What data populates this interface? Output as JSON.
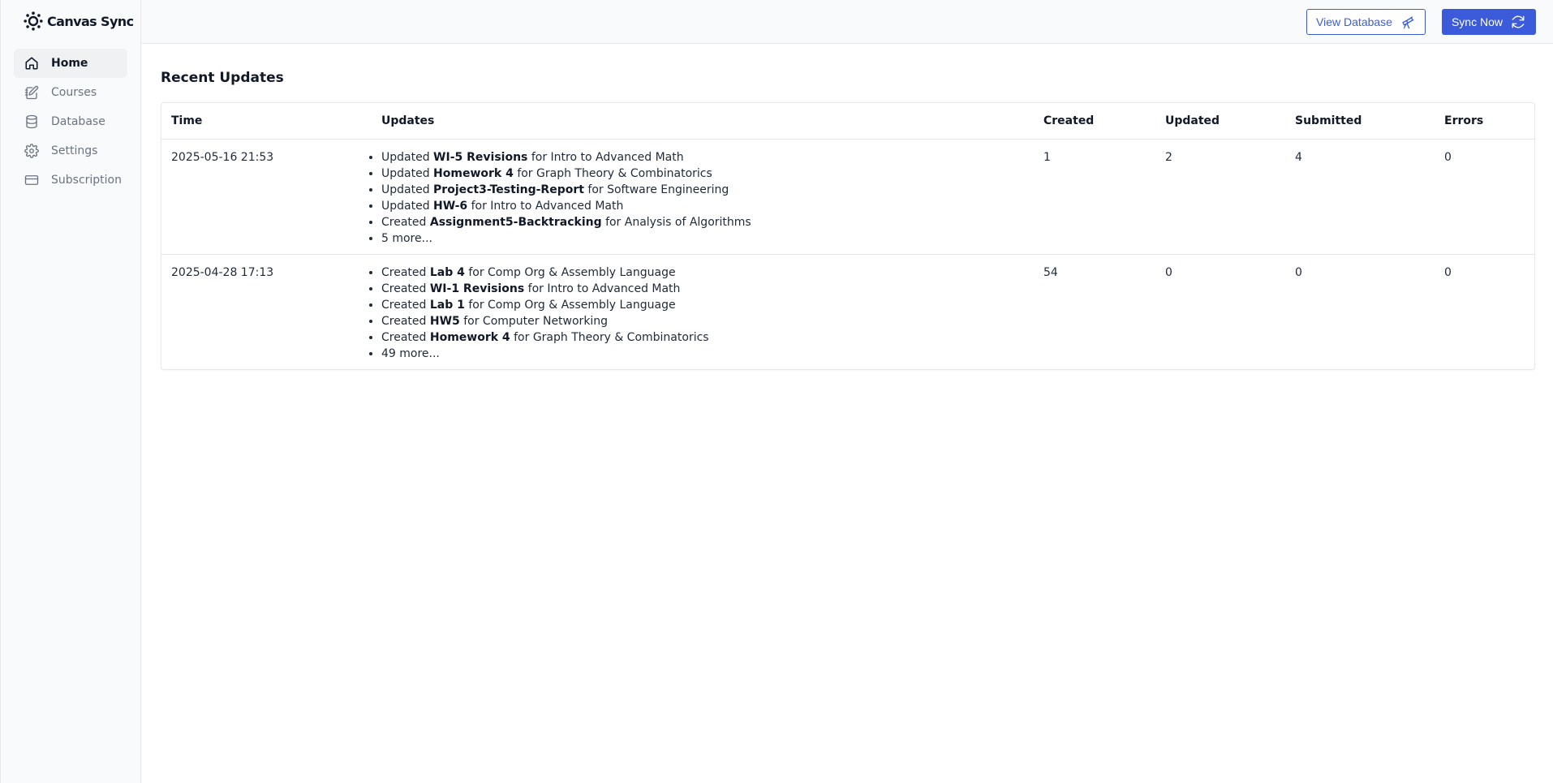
{
  "app": {
    "name": "Canvas Sync"
  },
  "sidebar": {
    "items": [
      {
        "label": "Home",
        "icon": "home-icon",
        "active": true
      },
      {
        "label": "Courses",
        "icon": "courses-icon",
        "active": false
      },
      {
        "label": "Database",
        "icon": "database-icon",
        "active": false
      },
      {
        "label": "Settings",
        "icon": "gear-icon",
        "active": false
      },
      {
        "label": "Subscription",
        "icon": "card-icon",
        "active": false
      }
    ]
  },
  "topbar": {
    "view_database_label": "View Database",
    "sync_now_label": "Sync Now"
  },
  "main": {
    "title": "Recent Updates",
    "columns": {
      "time": "Time",
      "updates": "Updates",
      "created": "Created",
      "updated": "Updated",
      "submitted": "Submitted",
      "errors": "Errors"
    },
    "rows": [
      {
        "time": "2025-05-16 21:53",
        "updates": [
          {
            "action": "Updated",
            "name": "WI-5 Revisions",
            "suffix": "for Intro to Advanced Math"
          },
          {
            "action": "Updated",
            "name": "Homework 4",
            "suffix": "for Graph Theory & Combinatorics"
          },
          {
            "action": "Updated",
            "name": "Project3-Testing-Report",
            "suffix": "for Software Engineering"
          },
          {
            "action": "Updated",
            "name": "HW-6",
            "suffix": "for Intro to Advanced Math"
          },
          {
            "action": "Created",
            "name": "Assignment5-Backtracking",
            "suffix": "for Analysis of Algorithms"
          }
        ],
        "more": "5 more...",
        "created": "1",
        "updated": "2",
        "submitted": "4",
        "errors": "0"
      },
      {
        "time": "2025-04-28 17:13",
        "updates": [
          {
            "action": "Created",
            "name": "Lab 4",
            "suffix": "for Comp Org & Assembly Language"
          },
          {
            "action": "Created",
            "name": "WI-1 Revisions",
            "suffix": "for Intro to Advanced Math"
          },
          {
            "action": "Created",
            "name": "Lab 1",
            "suffix": "for Comp Org & Assembly Language"
          },
          {
            "action": "Created",
            "name": "HW5",
            "suffix": "for Computer Networking"
          },
          {
            "action": "Created",
            "name": "Homework 4",
            "suffix": "for Graph Theory & Combinatorics"
          }
        ],
        "more": "49 more...",
        "created": "54",
        "updated": "0",
        "submitted": "0",
        "errors": "0"
      }
    ]
  },
  "colors": {
    "accent": "#3b5bdb",
    "sidebar_bg": "#f9fafb",
    "border": "#e5e7eb"
  }
}
